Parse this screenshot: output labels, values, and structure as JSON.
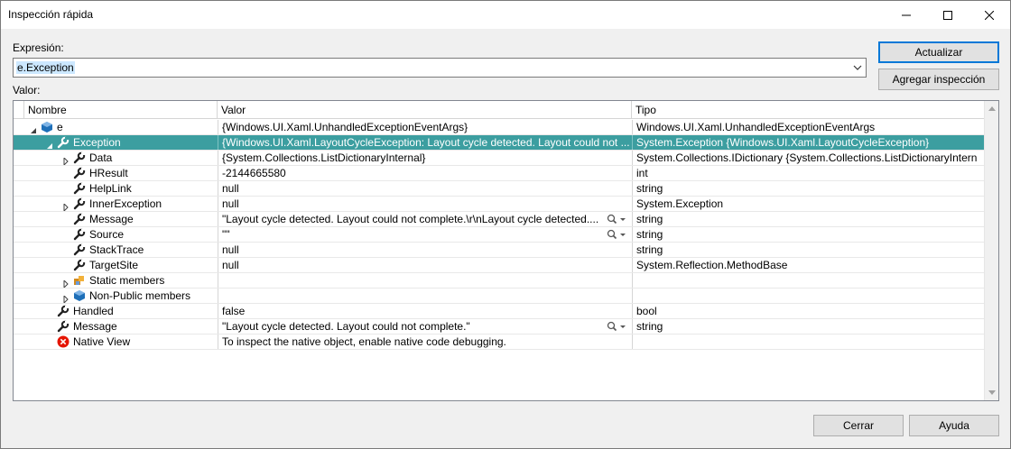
{
  "window": {
    "title": "Inspección rápida"
  },
  "expression": {
    "label": "Expresión:",
    "value": "e.Exception"
  },
  "buttons": {
    "update": "Actualizar",
    "add_watch": "Agregar inspección",
    "close": "Cerrar",
    "help": "Ayuda"
  },
  "grid": {
    "label": "Valor:",
    "columns": [
      "Nombre",
      "Valor",
      "Tipo"
    ],
    "rows": [
      {
        "name": "e",
        "value": "{Windows.UI.Xaml.UnhandledExceptionEventArgs}",
        "type": "Windows.UI.Xaml.UnhandledExceptionEventArgs",
        "icon": "object-icon",
        "expander": "expanded",
        "level": 0
      },
      {
        "name": "Exception",
        "value": "{Windows.UI.Xaml.LayoutCycleException: Layout cycle detected.  Layout could not ...",
        "type": "System.Exception {Windows.UI.Xaml.LayoutCycleException}",
        "icon": "property-icon",
        "expander": "expanded",
        "level": 1,
        "selected": true
      },
      {
        "name": "Data",
        "value": "{System.Collections.ListDictionaryInternal}",
        "type": "System.Collections.IDictionary {System.Collections.ListDictionaryIntern",
        "icon": "property-icon",
        "expander": "collapsed",
        "level": 2
      },
      {
        "name": "HResult",
        "value": "-2144665580",
        "type": "int",
        "icon": "property-icon",
        "expander": "none",
        "level": 2
      },
      {
        "name": "HelpLink",
        "value": "null",
        "type": "string",
        "icon": "property-icon",
        "expander": "none",
        "level": 2
      },
      {
        "name": "InnerException",
        "value": "null",
        "type": "System.Exception",
        "icon": "property-icon",
        "expander": "collapsed",
        "level": 2
      },
      {
        "name": "Message",
        "value": "\"Layout cycle detected.  Layout could not complete.\\r\\nLayout cycle detected....",
        "type": "string",
        "icon": "property-icon",
        "expander": "none",
        "level": 2,
        "visualizer": true
      },
      {
        "name": "Source",
        "value": "\"\"",
        "type": "string",
        "icon": "property-icon",
        "expander": "none",
        "level": 2,
        "visualizer": true
      },
      {
        "name": "StackTrace",
        "value": "null",
        "type": "string",
        "icon": "property-icon",
        "expander": "none",
        "level": 2
      },
      {
        "name": "TargetSite",
        "value": "null",
        "type": "System.Reflection.MethodBase",
        "icon": "property-icon",
        "expander": "none",
        "level": 2
      },
      {
        "name": "Static members",
        "value": "",
        "type": "",
        "icon": "static-members-icon",
        "expander": "collapsed",
        "level": 2
      },
      {
        "name": "Non-Public members",
        "value": "",
        "type": "",
        "icon": "object-icon",
        "expander": "collapsed",
        "level": 2
      },
      {
        "name": "Handled",
        "value": "false",
        "type": "bool",
        "icon": "property-icon",
        "expander": "none",
        "level": 1
      },
      {
        "name": "Message",
        "value": "\"Layout cycle detected.  Layout could not complete.\"",
        "type": "string",
        "icon": "property-icon",
        "expander": "none",
        "level": 1,
        "visualizer": true
      },
      {
        "name": "Native View",
        "value": "To inspect the native object, enable native code debugging.",
        "type": "",
        "icon": "error-icon",
        "expander": "none",
        "level": 1
      }
    ]
  },
  "colors": {
    "selection": "#3c9ea0",
    "accent": "#0078d7",
    "object_icon": "#1e6fb8",
    "error_icon": "#e51400"
  }
}
